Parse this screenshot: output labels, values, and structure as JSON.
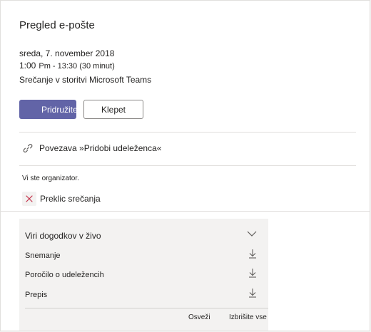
{
  "title": "Pregled e-pošte",
  "meeting": {
    "date": "sreda, 7. november 2018",
    "time_start": "1:00",
    "time_rest": "Pm - 13:30 (30 minut)",
    "location": "Srečanje v storitvi Microsoft Teams"
  },
  "buttons": {
    "join_label": "Pridružitev",
    "chat_label": "Klepet"
  },
  "attendee_link": {
    "label": "Povezava »Pridobi udeleženca«"
  },
  "organizer_note": "Vi ste organizator.",
  "cancel": {
    "label": "Preklic srečanja"
  },
  "live_resources": {
    "title": "Viri dogodkov v živo",
    "items": [
      {
        "label": "Snemanje"
      },
      {
        "label": "Poročilo o udeležencih"
      },
      {
        "label": "Prepis"
      }
    ],
    "refresh_label": "Osveži",
    "delete_all_label": "Izbrišite vse"
  },
  "colors": {
    "accent": "#6264a7",
    "cancel_icon": "#c4314b",
    "panel_bg": "#ffffff",
    "section_bg": "#f3f2f1"
  },
  "icons": {
    "link": "link-icon",
    "cancel": "close-icon",
    "collapse": "chevron-down-icon",
    "download": "download-icon"
  }
}
